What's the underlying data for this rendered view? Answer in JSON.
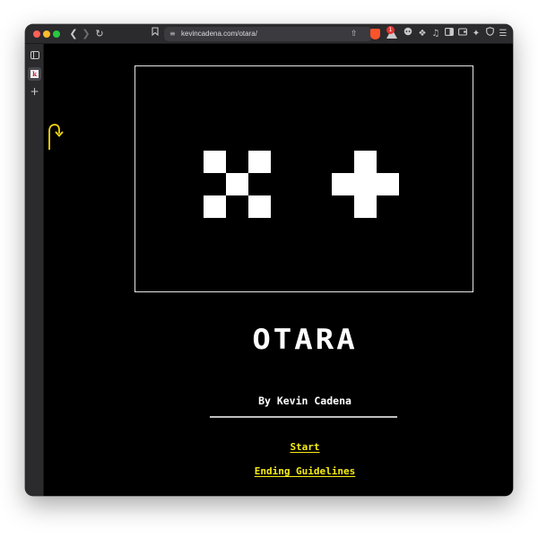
{
  "browser": {
    "url": "kevincadena.com/otara/",
    "favicon_letter": "k",
    "rewards_count": "1",
    "icons": {
      "back": "chevron-left-icon",
      "forward": "chevron-right-icon",
      "reload": "reload-icon",
      "bookmark": "bookmark-icon",
      "site_settings": "tune-icon",
      "share": "share-icon",
      "shields": "brave-shields-icon",
      "rewards": "brave-rewards-icon",
      "extensions": [
        "ai-chat-icon",
        "puzzle-icon",
        "music-icon",
        "sidebar-icon",
        "wallet-icon",
        "sparkle-icon",
        "vpn-shield-icon",
        "menu-icon"
      ]
    },
    "colors": {
      "chrome": "#2b2a2d",
      "address_bar": "#3b3a3e"
    }
  },
  "page": {
    "title": "OTARA",
    "byline": "By Kevin Cadena",
    "links": {
      "start": "Start",
      "ending": "Ending Guidelines"
    },
    "graphic": {
      "left_icon": "pixel-x-icon",
      "right_icon": "pixel-plus-icon"
    },
    "colors": {
      "background": "#000000",
      "text": "#ffffff",
      "link": "#f6ec15",
      "back_arrow": "#f6d80f"
    }
  }
}
